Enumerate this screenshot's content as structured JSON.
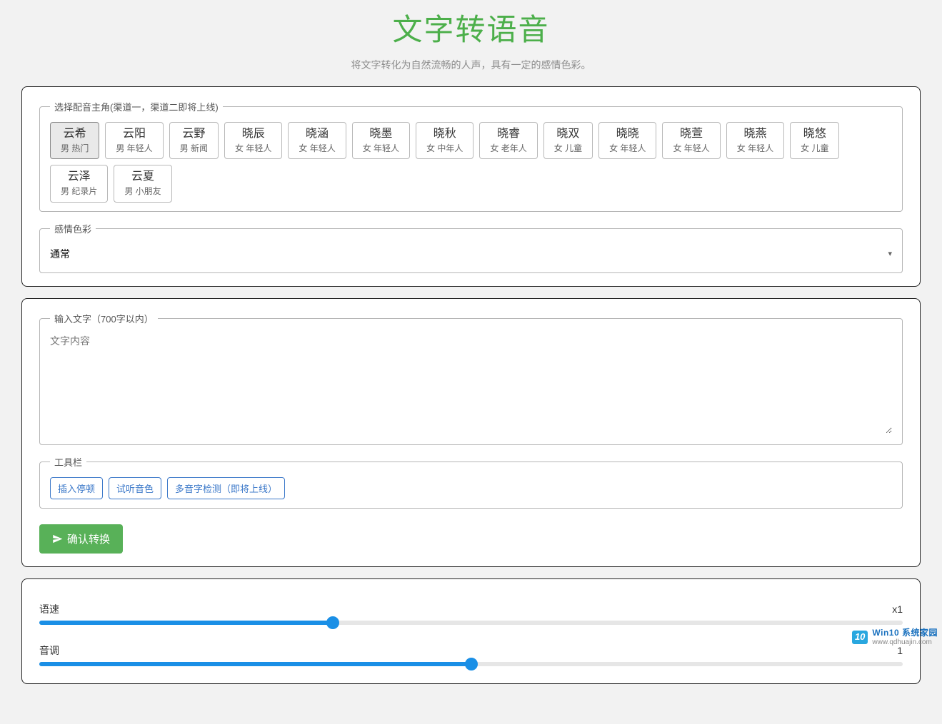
{
  "header": {
    "title": "文字转语音",
    "subtitle": "将文字转化为自然流畅的人声，具有一定的感情色彩。"
  },
  "voiceLegend": "选择配音主角(渠道一，渠道二即将上线)",
  "voices": [
    {
      "name": "云希",
      "sub": "男 热门",
      "active": true
    },
    {
      "name": "云阳",
      "sub": "男 年轻人"
    },
    {
      "name": "云野",
      "sub": "男 新闻"
    },
    {
      "name": "晓辰",
      "sub": "女 年轻人"
    },
    {
      "name": "晓涵",
      "sub": "女 年轻人"
    },
    {
      "name": "晓墨",
      "sub": "女 年轻人"
    },
    {
      "name": "晓秋",
      "sub": "女 中年人"
    },
    {
      "name": "晓睿",
      "sub": "女 老年人"
    },
    {
      "name": "晓双",
      "sub": "女 儿童"
    },
    {
      "name": "晓晓",
      "sub": "女 年轻人"
    },
    {
      "name": "晓萱",
      "sub": "女 年轻人"
    },
    {
      "name": "晓燕",
      "sub": "女 年轻人"
    },
    {
      "name": "晓悠",
      "sub": "女 儿童"
    },
    {
      "name": "云泽",
      "sub": "男 纪录片"
    },
    {
      "name": "云夏",
      "sub": "男 小朋友"
    }
  ],
  "emotionLegend": "感情色彩",
  "emotionSelected": "通常",
  "textLegend": "输入文字（700字以内）",
  "textPlaceholder": "文字内容",
  "toolbarLegend": "工具栏",
  "toolbar": {
    "insertPause": "插入停顿",
    "previewVoice": "试听音色",
    "polyphone": "多音字检测（即将上线）"
  },
  "confirmLabel": "确认转换",
  "sliders": {
    "speed": {
      "label": "语速",
      "value": "x1",
      "pct": 34
    },
    "pitch": {
      "label": "音调",
      "value": "1",
      "pct": 50
    }
  },
  "watermark": {
    "brand": "Win10 系统家园",
    "url": "www.qdhuajin.com",
    "badge": "10"
  }
}
